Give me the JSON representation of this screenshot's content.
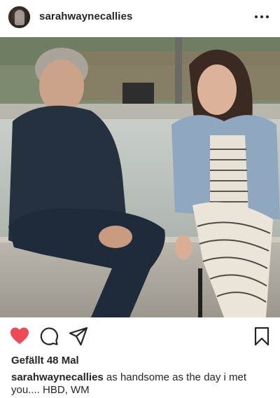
{
  "post": {
    "username": "sarahwaynecallies",
    "likes_text": "Gefällt 48 Mal",
    "caption_user": "sarahwaynecallies",
    "caption_text": " as handsome as the day i met you.... HBD, WM",
    "liked": true
  },
  "icons": {
    "more": "more-options-icon",
    "like": "heart-icon",
    "comment": "comment-icon",
    "share": "paper-plane-icon",
    "save": "bookmark-icon"
  },
  "colors": {
    "like_red": "#ed4956",
    "text": "#262626"
  }
}
